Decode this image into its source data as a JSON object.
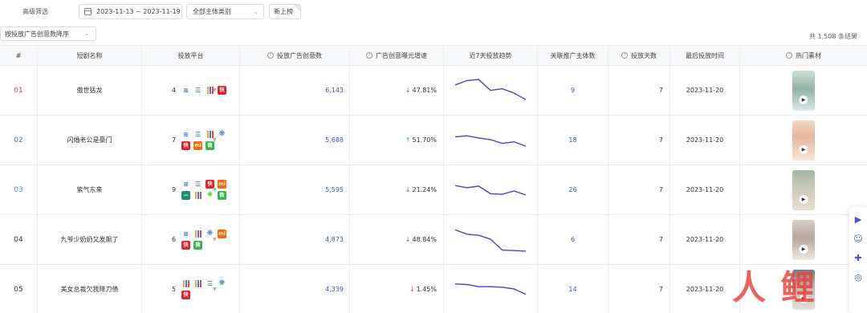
{
  "filters": {
    "label": "高级筛选",
    "date_range": "2023-11-13 ~ 2023-11-19",
    "type_select": "全部主体类别",
    "new_button": "新上榜"
  },
  "sort": {
    "label": "按投放广告创意数降序"
  },
  "total": "共 1,508 条结果",
  "columns": [
    "#",
    "短剧名称",
    "投放平台",
    "投放广告创意数",
    "广告创意曝光增速",
    "近7天投放趋势",
    "关联推广主体数",
    "投放天数",
    "最后投放时间",
    "热门素材"
  ],
  "rows": [
    {
      "rank": "01",
      "rank_color": "#e0433a",
      "name": "傲世猛龙",
      "platform_count": "4",
      "platforms": [
        "juliang-blue",
        "bars-blue",
        "bars-multi",
        "kuaishou-red"
      ],
      "creatives": "6,143",
      "growth_dir": "down",
      "growth": "47.81%",
      "trend": [
        62,
        70,
        72,
        52,
        55,
        47,
        35
      ],
      "entities": "9",
      "days": "7",
      "last_date": "2023-11-20",
      "thumb": "t1"
    },
    {
      "rank": "02",
      "rank_color": "#5a66d8",
      "name": "闪婚老公是豪门",
      "platform_count": "7",
      "platforms": [
        "juliang-blue",
        "bars-blue",
        "bars-multi",
        "paw-blue",
        "kuaishou-red",
        "xiaomi-orange",
        "wechat-green"
      ],
      "creatives": "5,688",
      "growth_dir": "up",
      "growth": "51.70%",
      "trend": [
        58,
        60,
        56,
        53,
        46,
        49,
        41
      ],
      "entities": "18",
      "days": "7",
      "last_date": "2023-11-20",
      "thumb": "t2"
    },
    {
      "rank": "03",
      "rank_color": "#4a8bd8",
      "name": "紫气东来",
      "platform_count": "9",
      "platforms": [
        "juliang-blue",
        "bars-blue",
        "kuaishou-red",
        "xiaomi-orange",
        "teal-bar",
        "bars-multi",
        "sun-green",
        "wechat-green"
      ],
      "creatives": "5,595",
      "growth_dir": "down",
      "growth": "21.24%",
      "trend": [
        60,
        56,
        59,
        45,
        44,
        50,
        43
      ],
      "entities": "26",
      "days": "7",
      "last_date": "2023-11-20",
      "thumb": "t3"
    },
    {
      "rank": "04",
      "rank_color": "#333333",
      "name": "九爷少奶奶又发飙了",
      "platform_count": "6",
      "platforms": [
        "juliang-blue",
        "bars-multi",
        "paw-blue",
        "xiaomi-orange",
        "kuaishou-red",
        "wechat-green"
      ],
      "creatives": "4,873",
      "growth_dir": "down",
      "growth": "48.84%",
      "trend": [
        70,
        62,
        60,
        53,
        33,
        32,
        31
      ],
      "entities": "6",
      "days": "7",
      "last_date": "2023-11-20",
      "thumb": "t4"
    },
    {
      "rank": "05",
      "rank_color": "#333333",
      "name": "美女总裁欠我降刀债",
      "platform_count": "5",
      "platforms": [
        "bars-multi",
        "bars-multi",
        "bars-blue",
        "paw-blue",
        "kuaishou-red"
      ],
      "creatives": "4,339",
      "growth_dir": "down",
      "growth": "1.45%",
      "trend": [
        62,
        61,
        57,
        57,
        56,
        53,
        43
      ],
      "entities": "14",
      "days": "7",
      "last_date": "2023-11-20",
      "thumb": "t5"
    }
  ],
  "icons": {
    "down_arrow": "↓",
    "up_arrow": "↑",
    "chevron": "⌄",
    "play": "▶"
  },
  "accent": "#3f51d8",
  "trend_color": "#4b3fd8",
  "watermark": "人人都是产品经理"
}
